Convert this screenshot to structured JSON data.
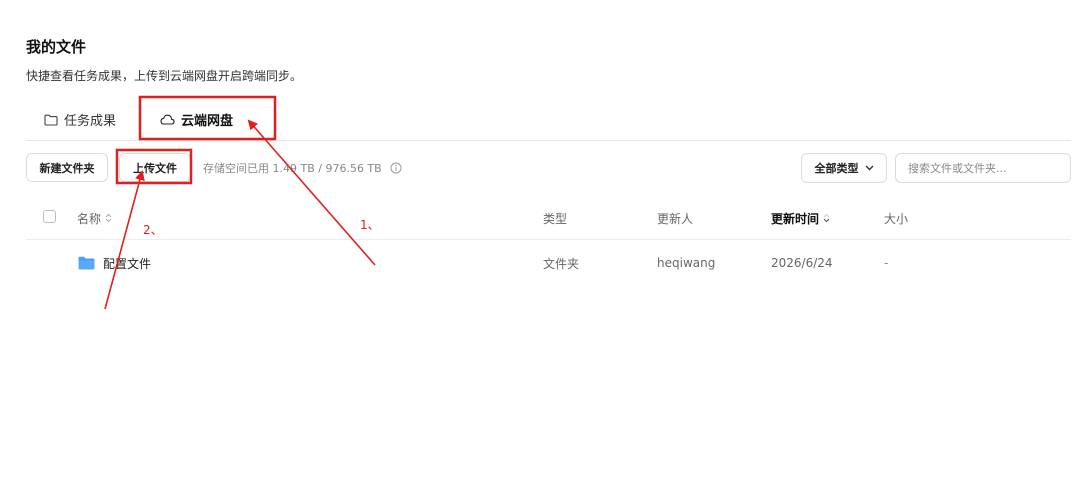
{
  "header": {
    "title": "我的文件",
    "subtitle": "快捷查看任务成果，上传到云端网盘开启跨端同步。"
  },
  "tabs": [
    {
      "label": "任务成果",
      "icon": "folder-outline-icon",
      "active": false
    },
    {
      "label": "云端网盘",
      "icon": "cloud-icon",
      "active": true
    }
  ],
  "toolbar": {
    "new_folder_label": "新建文件夹",
    "upload_label": "上传文件",
    "storage_text": "存储空间已用 1.49 TB / 976.56 TB",
    "type_filter_label": "全部类型",
    "search_placeholder": "搜索文件或文件夹...",
    "search_value": ""
  },
  "table": {
    "columns": [
      {
        "label": "名称",
        "sortable": true
      },
      {
        "label": "类型",
        "sortable": false
      },
      {
        "label": "更新人",
        "sortable": false
      },
      {
        "label": "更新时间",
        "sortable": true
      },
      {
        "label": "大小",
        "sortable": false
      }
    ],
    "rows": [
      {
        "name": "配置文件",
        "type": "文件夹",
        "updater": "heqiwang",
        "updated": "2026/6/24",
        "size": "-"
      }
    ]
  },
  "annotations": {
    "label_1": "1、",
    "label_2": "2、",
    "color": "#e02020"
  },
  "colors": {
    "folder": "#4a9ef5",
    "annotation": "#e02020"
  }
}
